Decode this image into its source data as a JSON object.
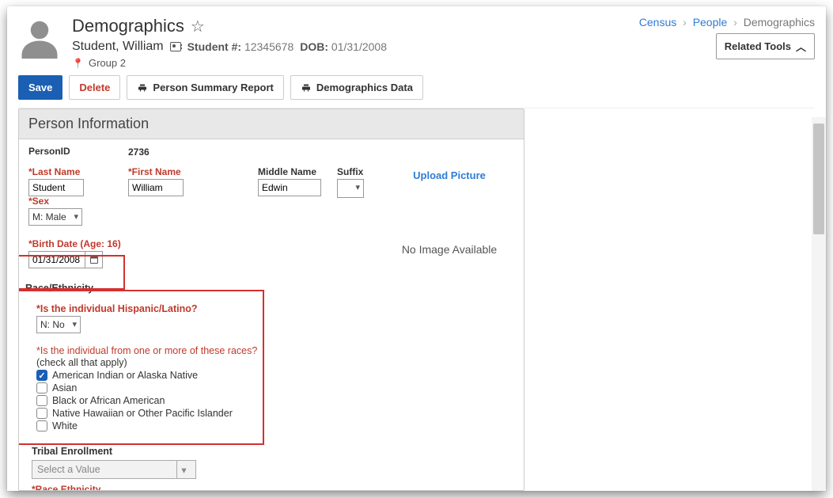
{
  "header": {
    "title": "Demographics",
    "name": "Student, William",
    "student_no_label": "Student #:",
    "student_no": "12345678",
    "dob_label": "DOB:",
    "dob": "01/31/2008",
    "group": "Group 2"
  },
  "crumbs": {
    "a": "Census",
    "b": "People",
    "c": "Demographics"
  },
  "related_label": "Related Tools",
  "toolbar": {
    "save": "Save",
    "delete": "Delete",
    "report": "Person Summary Report",
    "demo": "Demographics Data"
  },
  "panel": {
    "title": "Person Information",
    "person_id_label": "PersonID",
    "person_id": "2736",
    "last_name_label": "*Last Name",
    "last_name": "Student",
    "first_name_label": "*First Name",
    "first_name": "William",
    "middle_label": "Middle Name",
    "middle": "Edwin",
    "suffix_label": "Suffix",
    "sex_label": "*Sex",
    "sex_value": "M: Male",
    "birth_label": "*Birth Date (Age: 16)",
    "birth_value": "01/31/2008",
    "upload": "Upload Picture",
    "noimg": "No Image Available"
  },
  "race": {
    "section": "Race/Ethnicity",
    "q1": "*Is the individual Hispanic/Latino?",
    "q1_value": "N: No",
    "q2": "*Is the individual from one or more of these races?",
    "q2_hint": "(check all that apply)",
    "opts": [
      {
        "label": "American Indian or Alaska Native",
        "checked": true
      },
      {
        "label": "Asian",
        "checked": false
      },
      {
        "label": "Black or African American",
        "checked": false
      },
      {
        "label": "Native Hawaiian or Other Pacific Islander",
        "checked": false
      },
      {
        "label": "White",
        "checked": false
      }
    ]
  },
  "tribal": {
    "label": "Tribal Enrollment",
    "placeholder": "Select a Value"
  },
  "cut_label": "*Race Ethnicity"
}
